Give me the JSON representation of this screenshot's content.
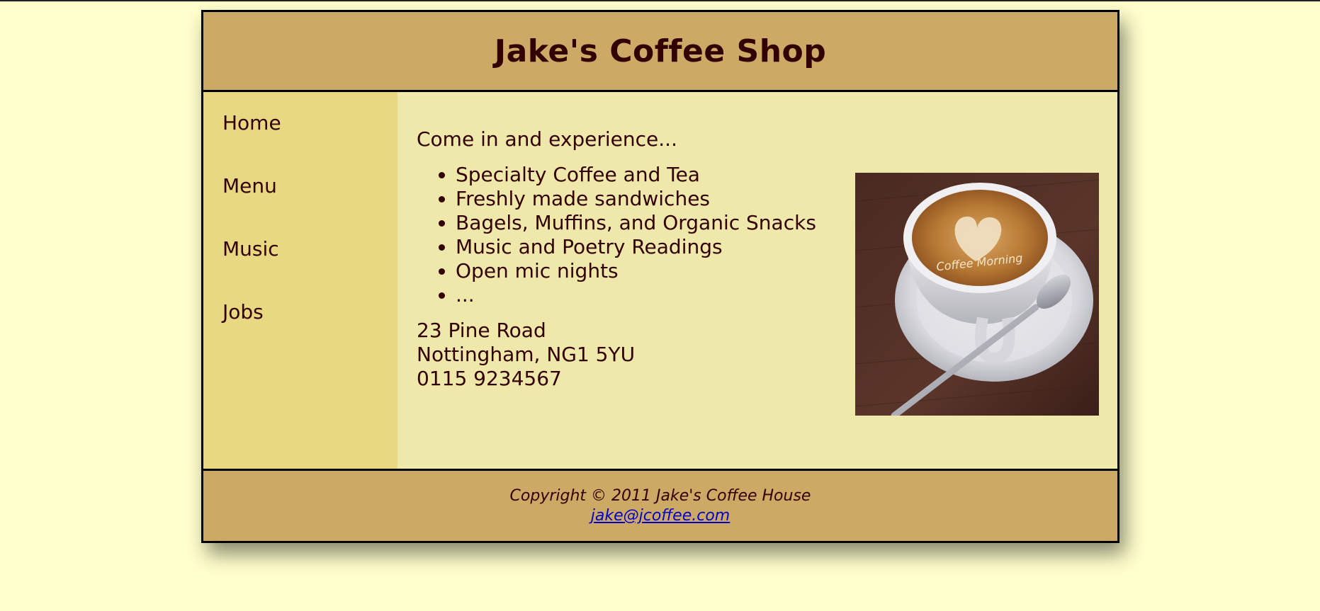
{
  "header": {
    "title": "Jake's Coffee Shop"
  },
  "nav": {
    "items": [
      {
        "label": "Home"
      },
      {
        "label": "Menu"
      },
      {
        "label": "Music"
      },
      {
        "label": "Jobs"
      }
    ]
  },
  "main": {
    "intro": "Come in and experience...",
    "features": [
      "Specialty Coffee and Tea",
      "Freshly made sandwiches",
      "Bagels, Muffins, and Organic Snacks",
      "Music and Poetry Readings",
      "Open mic nights",
      "..."
    ],
    "address": {
      "street": "23 Pine Road",
      "city": "Nottingham, NG1 5YU",
      "phone": "0115 9234567"
    },
    "photo": {
      "foam_text": "Coffee Morning"
    }
  },
  "footer": {
    "copyright": "Copyright © 2011 Jake's Coffee House",
    "email": "jake@jcoffee.com"
  },
  "colors": {
    "page_bg": "#ffffcc",
    "header_bg": "#ccaa66",
    "nav_bg": "#e8d882",
    "main_bg": "#eee8aa",
    "text": "#330000",
    "link": "#0000cc"
  }
}
